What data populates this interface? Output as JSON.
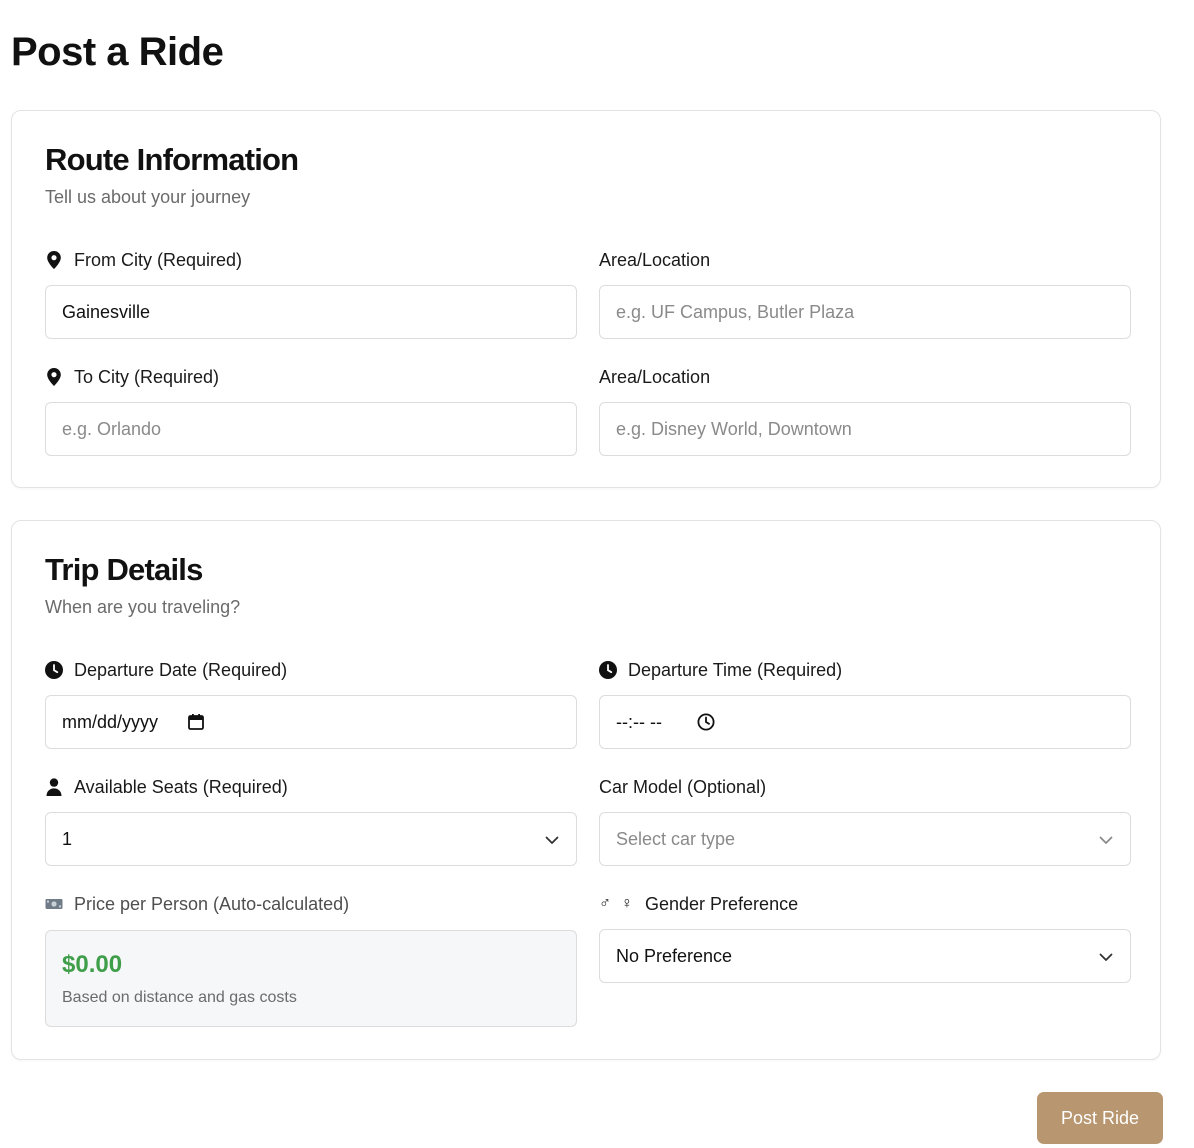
{
  "page": {
    "title": "Post a Ride"
  },
  "route": {
    "title": "Route Information",
    "subtitle": "Tell us about your journey",
    "from_city": {
      "label": "From City (Required)",
      "icon": "map-pin-icon",
      "value": "Gainesville",
      "placeholder": ""
    },
    "from_area": {
      "label": "Area/Location",
      "value": "",
      "placeholder": "e.g. UF Campus, Butler Plaza"
    },
    "to_city": {
      "label": "To City (Required)",
      "icon": "map-pin-icon",
      "value": "",
      "placeholder": "e.g. Orlando"
    },
    "to_area": {
      "label": "Area/Location",
      "value": "",
      "placeholder": "e.g. Disney World, Downtown"
    }
  },
  "trip": {
    "title": "Trip Details",
    "subtitle": "When are you traveling?",
    "departure_date": {
      "label": "Departure Date (Required)",
      "icon": "clock-icon",
      "value": "mm/dd/yyyy",
      "trail_icon": "calendar-icon"
    },
    "departure_time": {
      "label": "Departure Time (Required)",
      "icon": "clock-icon",
      "value": "--:-- --",
      "trail_icon": "clock-outline-icon"
    },
    "seats": {
      "label": "Available Seats (Required)",
      "icon": "person-icon",
      "selected": "1"
    },
    "car_model": {
      "label": "Car Model (Optional)",
      "selected": "Select car type"
    },
    "price": {
      "label": "Price per Person (Auto-calculated)",
      "icon": "money-icon",
      "value": "$0.00",
      "note": "Based on distance and gas costs"
    },
    "gender": {
      "label": "Gender Preference",
      "icon_male": "♂",
      "icon_female": "♀",
      "selected": "No Preference"
    }
  },
  "actions": {
    "post_label": "Post Ride"
  },
  "colors": {
    "accent_button": "#b89670",
    "price_green": "#3f9e4a",
    "border": "#dcdcdc",
    "muted_text": "#6b6b6b"
  }
}
